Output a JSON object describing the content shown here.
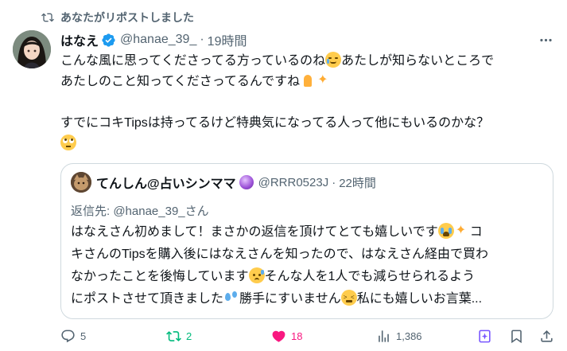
{
  "repost_banner": {
    "text": "あなたがリポストしました"
  },
  "post": {
    "display_name": "はなえ",
    "handle": "@hanae_39_",
    "dot": "·",
    "time": "19時間",
    "lines": [
      "こんな風に思ってくださってる方っているのね",
      "あたしが知らないところで",
      "あたしのこと知ってくださってるんですね",
      "すでにコキTipsは持ってるけど特典気になってる人って他にもいるのかな？"
    ]
  },
  "quote": {
    "display_name": "てんしん@占いシンママ",
    "handle": "@RRR0523J",
    "dot": "·",
    "time": "22時間",
    "replying_to": "返信先: @hanae_39_さん",
    "lines": [
      "はなえさん初めまして！まさかの返信を頂けてとても嬉しいです",
      "コ",
      "キさんのTipsを購入後にはなえさんを知ったので、はなえさん経由で買わ",
      "なかったことを後悔しています",
      "そんな人を1人でも減らせられるよう",
      "にポストさせて頂きました",
      "勝手にすいません",
      "私にも嬉しいお言葉..."
    ]
  },
  "actions": {
    "reply_count": "5",
    "repost_count": "2",
    "like_count": "18",
    "views_count": "1,386"
  },
  "colors": {
    "text": "#0f1419",
    "secondary": "#536471",
    "accent_blue": "#1d9bf0",
    "repost_green": "#00ba7c",
    "like_pink": "#f91880",
    "border": "#cfd9de"
  },
  "icons": [
    "repost-icon",
    "verified-badge-icon",
    "more-icon",
    "reply-icon",
    "repost-icon",
    "heart-icon",
    "views-icon",
    "grok-icon",
    "bookmark-icon",
    "share-icon"
  ]
}
